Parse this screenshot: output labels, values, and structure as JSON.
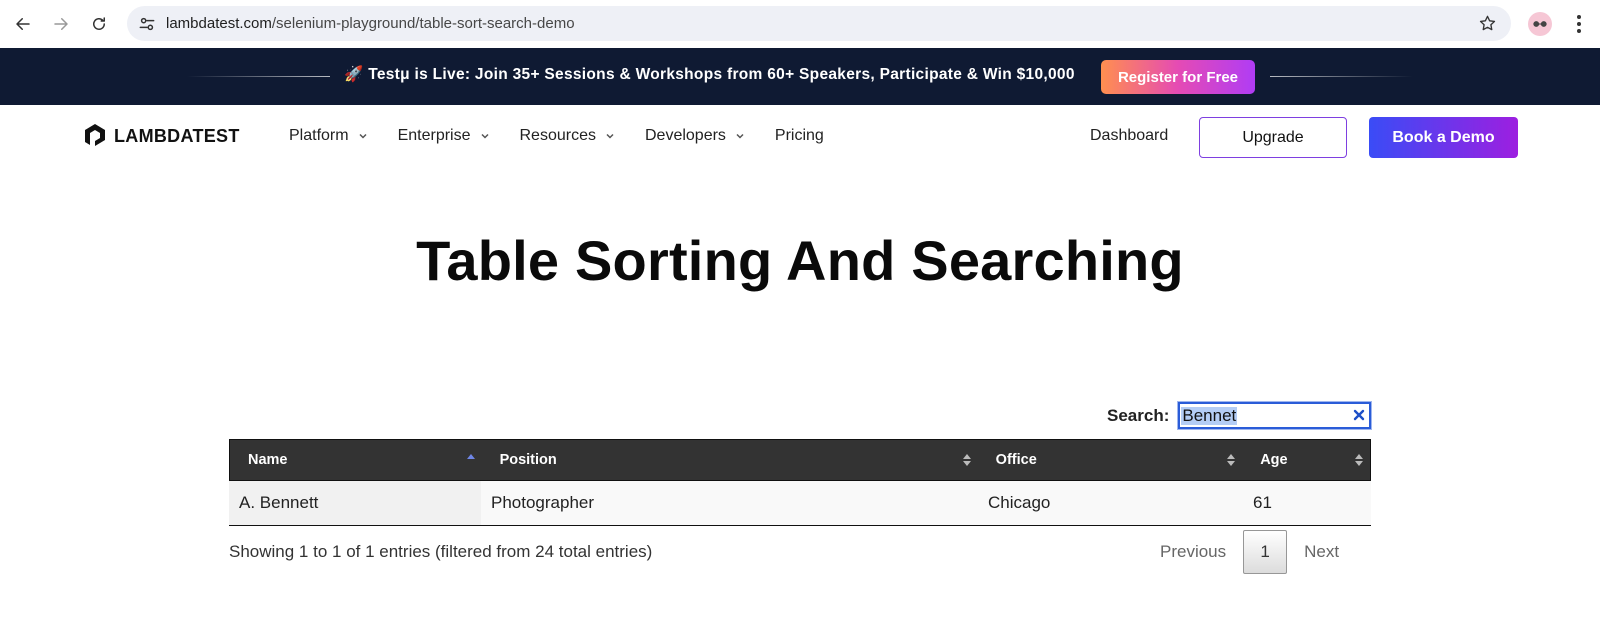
{
  "browser": {
    "url_host": "lambdatest.com",
    "url_path": "/selenium-playground/table-sort-search-demo"
  },
  "announcement": {
    "message": "🚀 Testμ is Live: Join 35+ Sessions & Workshops from 60+ Speakers, Participate & Win $10,000",
    "cta": "Register for Free"
  },
  "nav": {
    "brand": "LAMBDATEST",
    "items": [
      {
        "label": "Platform"
      },
      {
        "label": "Enterprise"
      },
      {
        "label": "Resources"
      },
      {
        "label": "Developers"
      },
      {
        "label": "Pricing"
      }
    ],
    "dashboard": "Dashboard",
    "upgrade": "Upgrade",
    "book_demo": "Book a Demo"
  },
  "page": {
    "title": "Table Sorting And Searching"
  },
  "search": {
    "label": "Search:",
    "value": "Bennet"
  },
  "table": {
    "columns": [
      "Name",
      "Position",
      "Office",
      "Age"
    ],
    "rows": [
      [
        "A. Bennett",
        "Photographer",
        "Chicago",
        "61"
      ]
    ],
    "sorted_column": "Name",
    "sort_direction": "ascending"
  },
  "footer": {
    "info": "Showing 1 to 1 of 1 entries (filtered from 24 total entries)",
    "previous": "Previous",
    "current_page": "1",
    "next": "Next"
  },
  "colors": {
    "announce_bg": "#0f1a33",
    "header_bg": "#333333",
    "accent_start": "#3a4cf6",
    "accent_end": "#9d1fe0"
  }
}
